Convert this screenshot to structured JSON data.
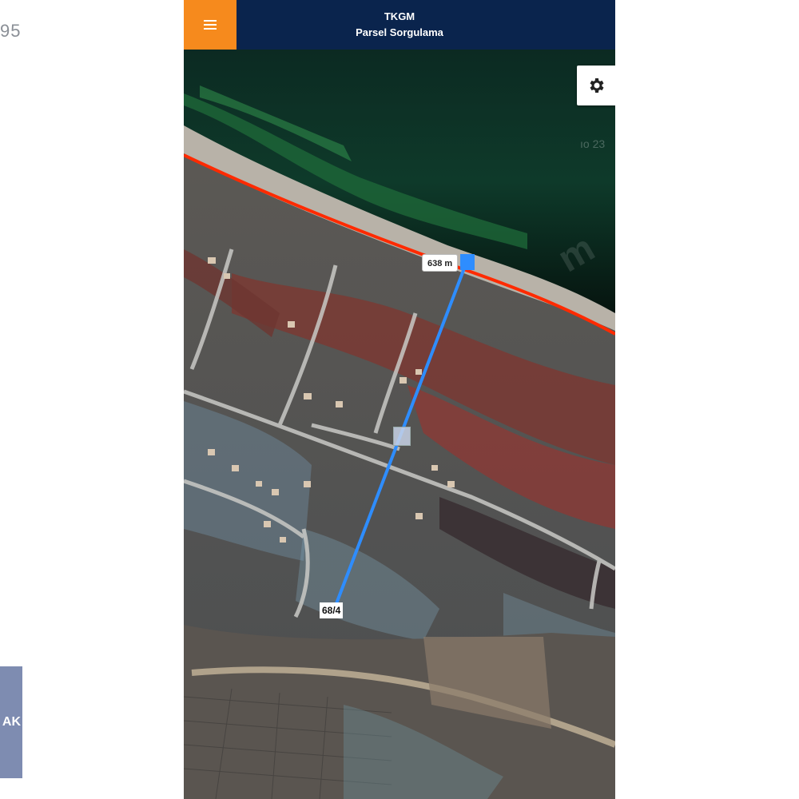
{
  "left_panel": {
    "number_fragment": "95",
    "button_fragment": "AK"
  },
  "app": {
    "title": "TKGM",
    "subtitle": "Parsel Sorgulama",
    "menu_icon": "hamburger-icon",
    "settings_icon": "gear-icon"
  },
  "map": {
    "measurement_label": "638 m",
    "parcel_label": "68/4",
    "watermark": "m",
    "faint_text": "ıo 23",
    "colors": {
      "header": "#0a244d",
      "menu": "#f68a1d",
      "measure_line": "#2e8dff",
      "boundary_line": "#ff2a00"
    }
  }
}
